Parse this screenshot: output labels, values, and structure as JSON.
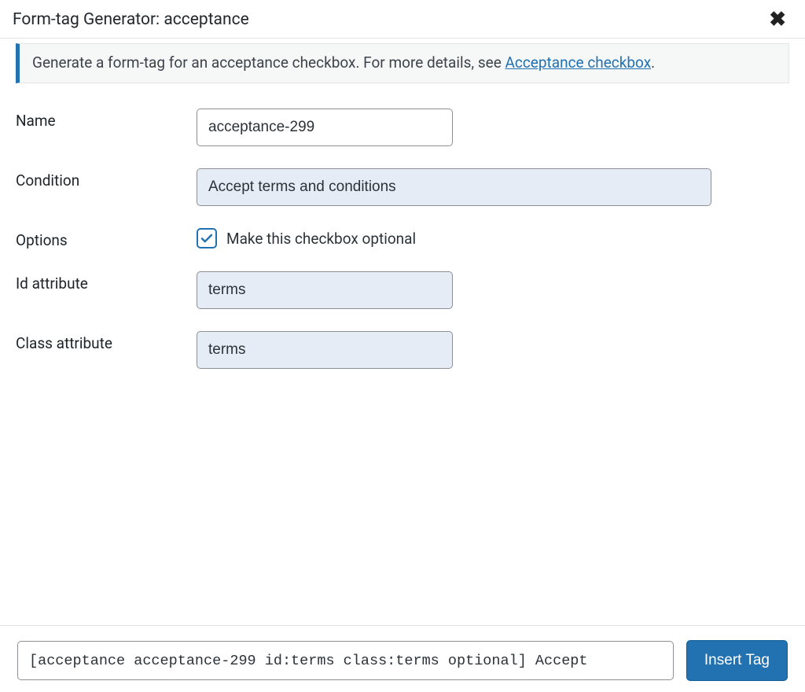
{
  "header": {
    "title": "Form-tag Generator: acceptance"
  },
  "notice": {
    "prefix": "Generate a form-tag for an acceptance checkbox. For more details, see ",
    "link_text": "Acceptance checkbox",
    "suffix": "."
  },
  "fields": {
    "name": {
      "label": "Name",
      "value": "acceptance-299"
    },
    "condition": {
      "label": "Condition",
      "value": "Accept terms and conditions"
    },
    "options": {
      "label": "Options",
      "checkbox_label": "Make this checkbox optional",
      "checked": true
    },
    "id_attr": {
      "label": "Id attribute",
      "value": "terms"
    },
    "class_attr": {
      "label": "Class attribute",
      "value": "terms"
    }
  },
  "footer": {
    "tag_output": "[acceptance acceptance-299 id:terms class:terms optional] Accept",
    "insert_label": "Insert Tag"
  }
}
